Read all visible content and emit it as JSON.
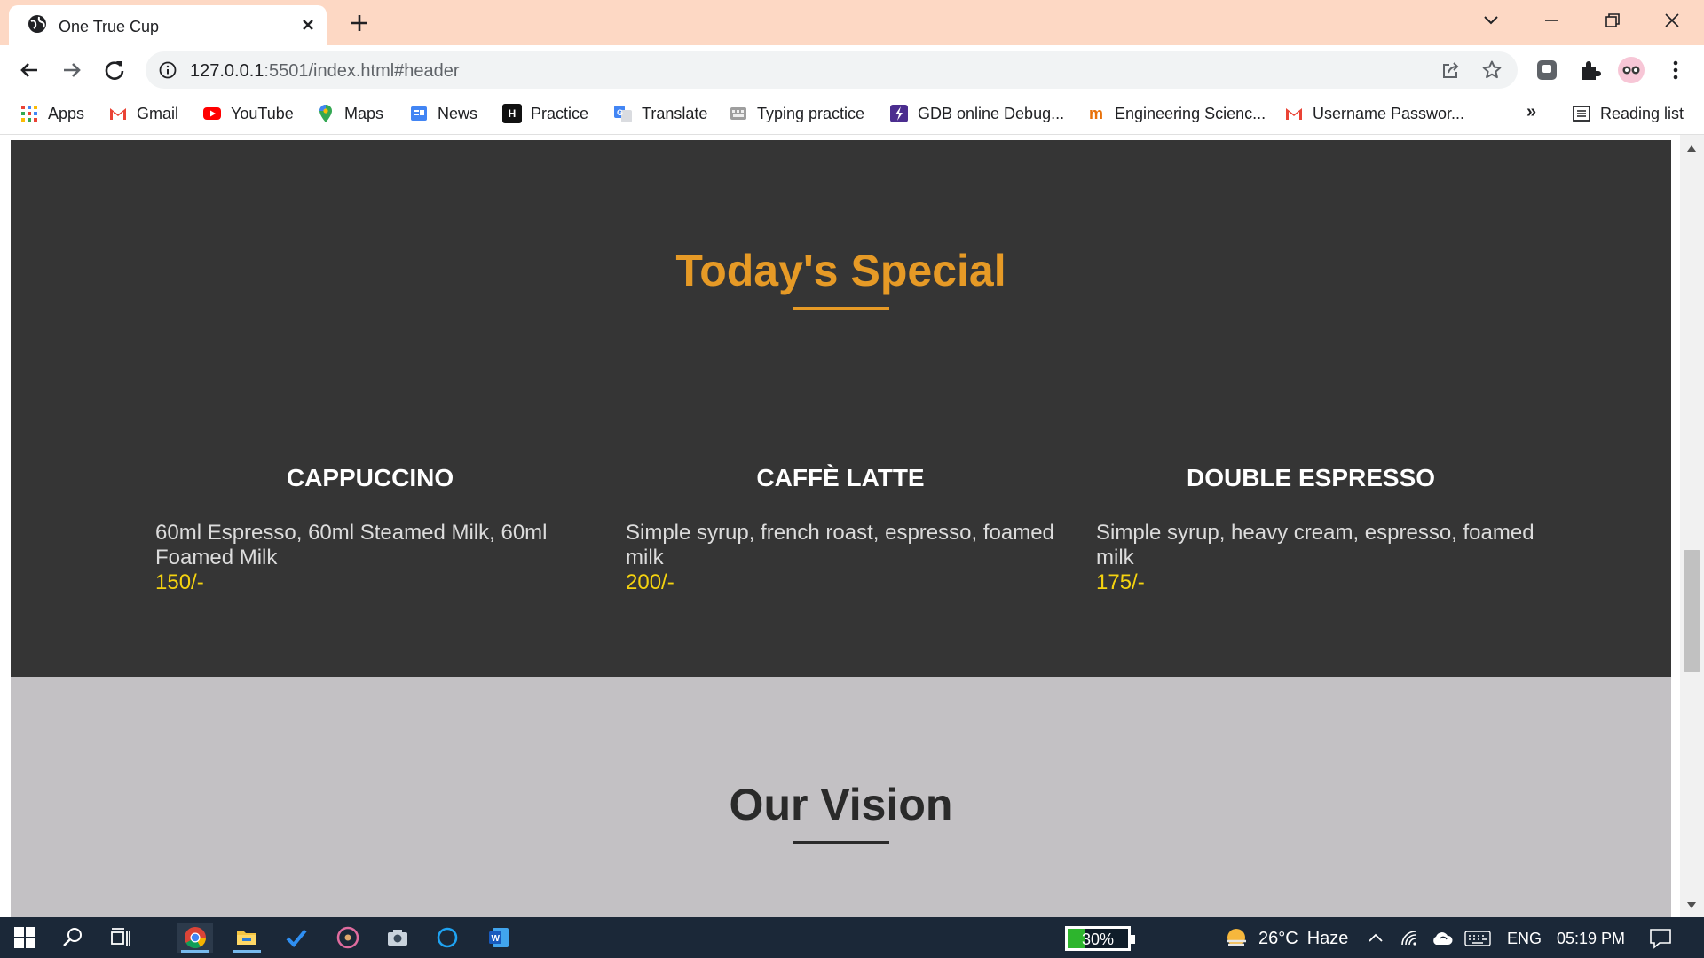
{
  "browser": {
    "tab_title": "One True Cup",
    "url_host": "127.0.0.1",
    "url_rest": ":5501/index.html#header",
    "bookmarks": [
      {
        "label": "Apps",
        "icon": "apps-grid-icon"
      },
      {
        "label": "Gmail",
        "icon": "gmail-icon"
      },
      {
        "label": "YouTube",
        "icon": "youtube-icon"
      },
      {
        "label": "Maps",
        "icon": "maps-pin-icon"
      },
      {
        "label": "News",
        "icon": "google-news-icon"
      },
      {
        "label": "Practice",
        "icon": "hackerrank-icon"
      },
      {
        "label": "Translate",
        "icon": "translate-icon"
      },
      {
        "label": "Typing practice",
        "icon": "typing-icon"
      },
      {
        "label": "GDB online Debug...",
        "icon": "gdb-icon"
      },
      {
        "label": "Engineering Scienc...",
        "icon": "engineering-icon"
      },
      {
        "label": "Username Passwor...",
        "icon": "gmail-icon"
      }
    ],
    "bookmarks_overflow": "»",
    "reading_list": "Reading list"
  },
  "page": {
    "special": {
      "title": "Today's Special",
      "items": [
        {
          "name": "CAPPUCCINO",
          "description": "60ml Espresso, 60ml Steamed Milk, 60ml Foamed Milk",
          "price": "150/-"
        },
        {
          "name": "CAFFÈ LATTE",
          "description": "Simple syrup, french roast, espresso, foamed milk",
          "price": "200/-"
        },
        {
          "name": "DOUBLE ESPRESSO",
          "description": "Simple syrup, heavy cream, espresso, foamed milk",
          "price": "175/-"
        }
      ]
    },
    "vision": {
      "title": "Our Vision"
    }
  },
  "taskbar": {
    "battery": {
      "label": "30%",
      "level": 0.3
    },
    "weather": {
      "temp": "26°C",
      "condition": "Haze"
    },
    "language": "ENG",
    "time": "05:19 PM"
  },
  "colors": {
    "accent": "#e69a26",
    "price": "#f5d30f",
    "dark_section": "#353535",
    "light_section": "#c3c1c4",
    "tabstrip": "#fdd8c4"
  }
}
